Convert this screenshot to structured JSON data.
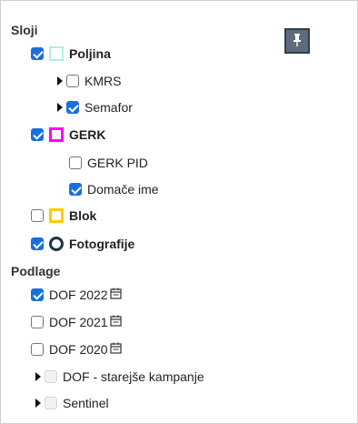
{
  "layers": {
    "heading": "Sloji",
    "items": [
      {
        "label": "Poljina",
        "checked": true,
        "symbol": "cyan-square"
      },
      {
        "label": "KMRS",
        "checked": false
      },
      {
        "label": "Semafor",
        "checked": true
      },
      {
        "label": "GERK",
        "checked": true,
        "symbol": "magenta-square"
      },
      {
        "label": "GERK PID",
        "checked": false
      },
      {
        "label": "Domače ime",
        "checked": true
      },
      {
        "label": "Blok",
        "checked": false,
        "symbol": "yellow-square"
      },
      {
        "label": "Fotografije",
        "checked": true,
        "symbol": "dark-circle"
      }
    ]
  },
  "basemaps": {
    "heading": "Podlage",
    "items": [
      {
        "label": "DOF 2022",
        "checked": true,
        "icon": "calendar-icon"
      },
      {
        "label": "DOF 2021",
        "checked": false,
        "icon": "calendar-icon"
      },
      {
        "label": "DOF 2020",
        "checked": false,
        "icon": "calendar-icon"
      },
      {
        "label": "DOF - starejše kampanje",
        "checked": false,
        "disabled": true
      },
      {
        "label": "Sentinel",
        "checked": false,
        "disabled": true
      }
    ]
  },
  "pin_button": {
    "icon": "pin-icon"
  },
  "colors": {
    "checkbox_checked": "#1a6fe0",
    "poljina_symbol": "#a8f0f0",
    "gerk_symbol": "#ff00ff",
    "blok_symbol": "#ffcc00",
    "foto_symbol": "#1c3444",
    "pin_button_bg": "#5d6b7a"
  }
}
